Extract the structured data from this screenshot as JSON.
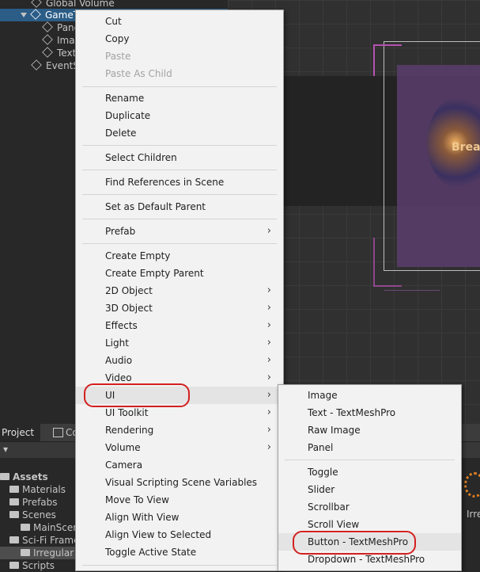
{
  "hierarchy": {
    "items": [
      {
        "label": "Global Volume"
      },
      {
        "label": "GameT"
      },
      {
        "label": "Panel"
      },
      {
        "label": "Imag"
      },
      {
        "label": "Text"
      },
      {
        "label": "EventS"
      }
    ]
  },
  "scene": {
    "overlay_text": "Brea"
  },
  "project_panel": {
    "tab_project": "Project",
    "tab_console": "Co",
    "tree": [
      {
        "label": "Assets"
      },
      {
        "label": "Materials"
      },
      {
        "label": "Prefabs"
      },
      {
        "label": "Scenes"
      },
      {
        "label": "MainScen"
      },
      {
        "label": "Sci-Fi Frame"
      },
      {
        "label": "Irregular F"
      },
      {
        "label": "Scripts"
      }
    ],
    "right_label": "Irre"
  },
  "context_menu": {
    "groups": [
      [
        {
          "label": "Cut",
          "enabled": true
        },
        {
          "label": "Copy",
          "enabled": true
        },
        {
          "label": "Paste",
          "enabled": false
        },
        {
          "label": "Paste As Child",
          "enabled": false
        }
      ],
      [
        {
          "label": "Rename",
          "enabled": true
        },
        {
          "label": "Duplicate",
          "enabled": true
        },
        {
          "label": "Delete",
          "enabled": true
        }
      ],
      [
        {
          "label": "Select Children",
          "enabled": true
        }
      ],
      [
        {
          "label": "Find References in Scene",
          "enabled": true
        }
      ],
      [
        {
          "label": "Set as Default Parent",
          "enabled": true
        }
      ],
      [
        {
          "label": "Prefab",
          "enabled": true,
          "submenu": true
        }
      ],
      [
        {
          "label": "Create Empty",
          "enabled": true
        },
        {
          "label": "Create Empty Parent",
          "enabled": true
        },
        {
          "label": "2D Object",
          "enabled": true,
          "submenu": true
        },
        {
          "label": "3D Object",
          "enabled": true,
          "submenu": true
        },
        {
          "label": "Effects",
          "enabled": true,
          "submenu": true
        },
        {
          "label": "Light",
          "enabled": true,
          "submenu": true
        },
        {
          "label": "Audio",
          "enabled": true,
          "submenu": true
        },
        {
          "label": "Video",
          "enabled": true,
          "submenu": true
        },
        {
          "label": "UI",
          "enabled": true,
          "submenu": true,
          "highlighted": true
        },
        {
          "label": "UI Toolkit",
          "enabled": true,
          "submenu": true
        },
        {
          "label": "Rendering",
          "enabled": true,
          "submenu": true
        },
        {
          "label": "Volume",
          "enabled": true,
          "submenu": true
        },
        {
          "label": "Camera",
          "enabled": true
        },
        {
          "label": "Visual Scripting Scene Variables",
          "enabled": true
        },
        {
          "label": "Move To View",
          "enabled": true
        },
        {
          "label": "Align With View",
          "enabled": true
        },
        {
          "label": "Align View to Selected",
          "enabled": true
        },
        {
          "label": "Toggle Active State",
          "enabled": true
        }
      ]
    ]
  },
  "ui_submenu": {
    "groups": [
      [
        {
          "label": "Image"
        },
        {
          "label": "Text - TextMeshPro"
        },
        {
          "label": "Raw Image"
        },
        {
          "label": "Panel"
        }
      ],
      [
        {
          "label": "Toggle"
        },
        {
          "label": "Slider"
        },
        {
          "label": "Scrollbar"
        },
        {
          "label": "Scroll View"
        },
        {
          "label": "Button - TextMeshPro",
          "highlighted": true
        },
        {
          "label": "Dropdown - TextMeshPro"
        }
      ]
    ]
  },
  "annotation_color": "#d42020"
}
